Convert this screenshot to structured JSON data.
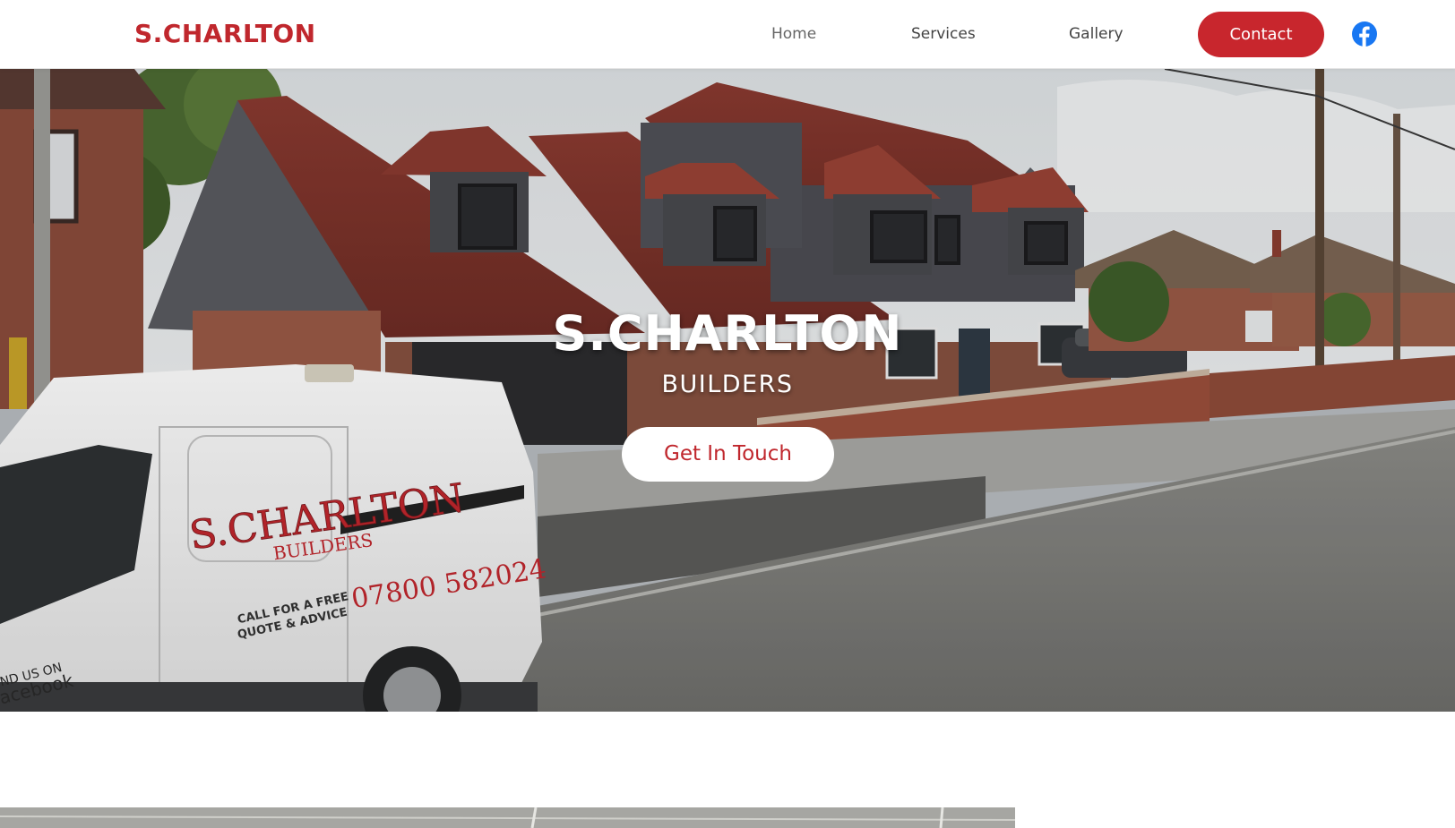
{
  "header": {
    "logo_text": "S.CHARLTON",
    "nav": {
      "home": "Home",
      "services": "Services",
      "gallery": "Gallery"
    },
    "contact_label": "Contact",
    "social_icon": "facebook-icon"
  },
  "hero": {
    "title": "S.CHARLTON",
    "subtitle": "BUILDERS",
    "cta_label": "Get In Touch",
    "van": {
      "brand": "S.CHARLTON",
      "brand_sub": "BUILDERS",
      "phone": "07800 582024",
      "tagline_line1": "CALL FOR A FREE",
      "tagline_line2": "QUOTE & ADVICE",
      "side_text_line1": "ND US ON",
      "side_text_line2": "acebook"
    }
  },
  "colors": {
    "brand_red": "#c0272d",
    "button_red": "#c8262d",
    "facebook_blue": "#1877f2",
    "nav_text": "#444444"
  }
}
